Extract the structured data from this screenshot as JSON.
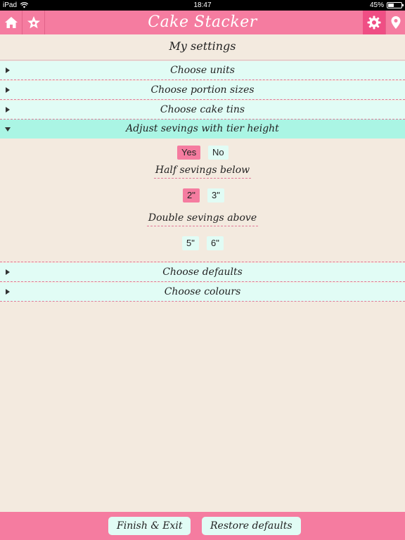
{
  "status_bar": {
    "device": "iPad",
    "time": "18:47",
    "battery_text": "45%",
    "battery_level": 0.45
  },
  "header": {
    "app_title": "Cake Stacker"
  },
  "page": {
    "title": "My settings"
  },
  "sections": {
    "units": {
      "label": "Choose units",
      "expanded": false
    },
    "portions": {
      "label": "Choose portion sizes",
      "expanded": false
    },
    "tins": {
      "label": "Choose cake tins",
      "expanded": false
    },
    "adjust": {
      "label": "Adjust sevings with tier height",
      "expanded": true
    },
    "defaults": {
      "label": "Choose defaults",
      "expanded": false
    },
    "colours": {
      "label": "Choose colours",
      "expanded": false
    }
  },
  "adjust_panel": {
    "toggle": {
      "yes": "Yes",
      "no": "No",
      "selected": "Yes"
    },
    "half_label": "Half sevings below",
    "half_options": {
      "a": "2\"",
      "b": "3\"",
      "selected": "2\""
    },
    "double_label": "Double sevings above",
    "double_options": {
      "a": "5\"",
      "b": "6\"",
      "selected": null
    }
  },
  "footer": {
    "finish_label": "Finish & Exit",
    "restore_label": "Restore defaults"
  },
  "colors": {
    "accent_pink": "#f57ca0",
    "row_mint": "#e1fcf5",
    "row_active": "#aaf5e4",
    "background": "#f3eadf"
  },
  "icons": [
    "home-icon",
    "star-icon",
    "gear-icon",
    "location-pin-icon",
    "wifi-icon"
  ]
}
